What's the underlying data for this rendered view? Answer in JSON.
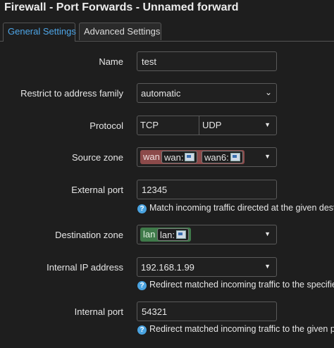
{
  "header": {
    "title": "Firewall - Port Forwards - Unnamed forward"
  },
  "tabs": [
    {
      "label": "General Settings",
      "active": true
    },
    {
      "label": "Advanced Settings",
      "active": false
    }
  ],
  "form": {
    "name": {
      "label": "Name",
      "value": "test"
    },
    "family": {
      "label": "Restrict to address family",
      "value": "automatic"
    },
    "protocol": {
      "label": "Protocol",
      "left": "TCP",
      "right": "UDP"
    },
    "source_zone": {
      "label": "Source zone",
      "zone": "wan",
      "ifaces": [
        "wan:",
        "wan6:"
      ],
      "color": "#8c4a4a"
    },
    "external_port": {
      "label": "External port",
      "value": "12345",
      "help": "Match incoming traffic directed at the given desti"
    },
    "dest_zone": {
      "label": "Destination zone",
      "zone": "lan",
      "ifaces": [
        "lan:"
      ],
      "color": "#3f7a4a"
    },
    "internal_ip": {
      "label": "Internal IP address",
      "value": "192.168.1.99",
      "help": "Redirect matched incoming traffic to the specifie"
    },
    "internal_port": {
      "label": "Internal port",
      "value": "54321",
      "help": "Redirect matched incoming traffic to the given po"
    }
  },
  "icons": {
    "help": "help-circle-icon",
    "chevron": "chevron-down-icon",
    "caret": "caret-down-icon",
    "nic": "network-interface-icon"
  }
}
